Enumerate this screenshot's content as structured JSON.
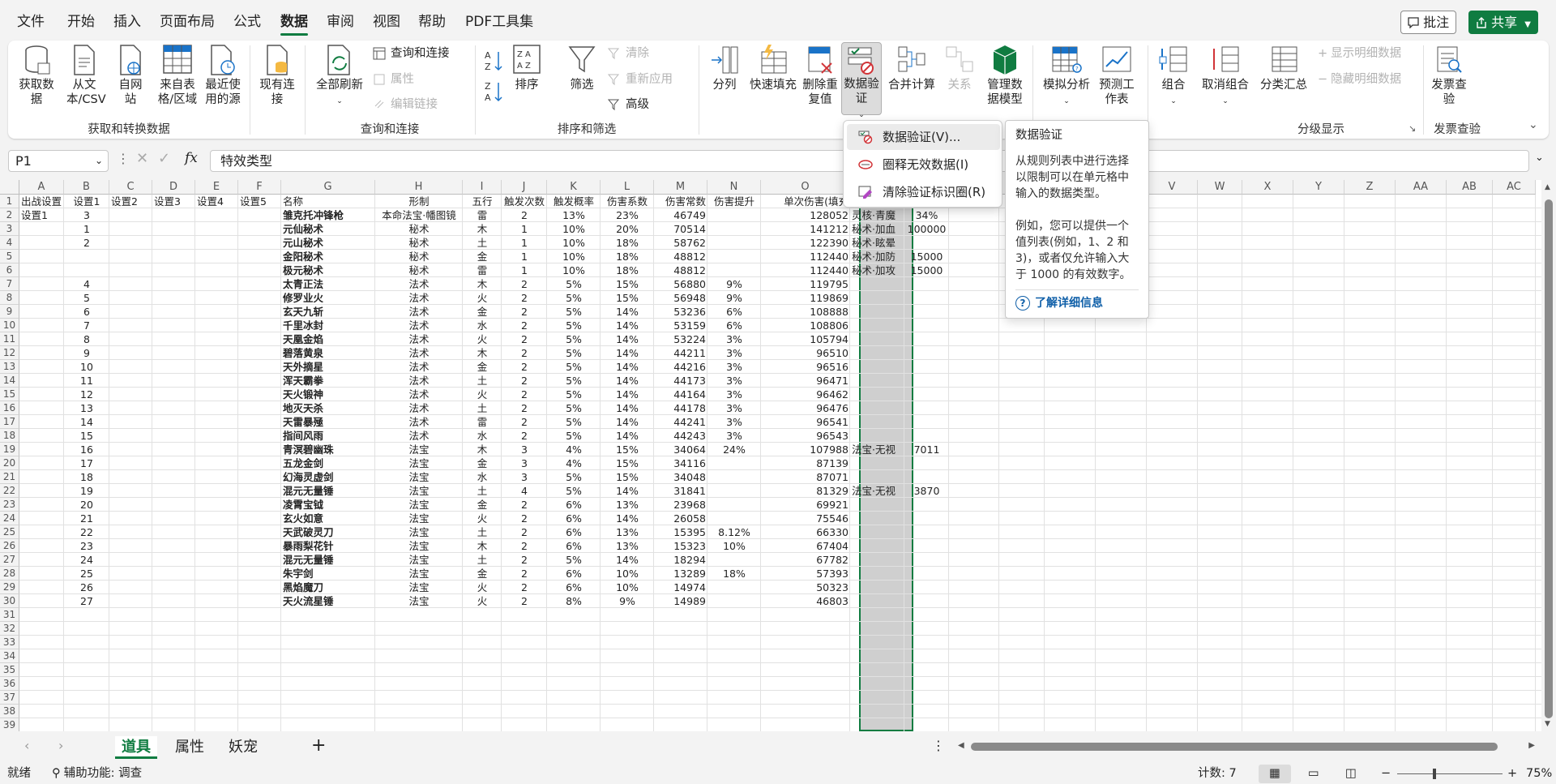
{
  "menu": {
    "file": "文件",
    "home": "开始",
    "insert": "插入",
    "page_layout": "页面布局",
    "formulas": "公式",
    "data": "数据",
    "review": "审阅",
    "view": "视图",
    "help": "帮助",
    "pdf": "PDF工具集",
    "comments": "批注",
    "share": "共享"
  },
  "ribbon": {
    "get_data": "获取数据",
    "from_text": "从文本/CSV",
    "from_web": "自网站",
    "from_table": "来自表格/区域",
    "recent_sources": "最近使用的源",
    "existing_connections": "现有连接",
    "group_get": "获取和转换数据",
    "refresh_all": "全部刷新",
    "queries_connections": "查询和连接",
    "properties": "属性",
    "edit_links": "编辑链接",
    "group_queries": "查询和连接",
    "sort_az": "A→Z",
    "sort_za": "Z→A",
    "sort": "排序",
    "filter": "筛选",
    "clear": "清除",
    "reapply": "重新应用",
    "advanced": "高级",
    "group_sort": "排序和筛选",
    "text_to_columns": "分列",
    "flash_fill": "快速填充",
    "remove_duplicates": "删除重复值",
    "data_validation": "数据验证",
    "consolidate": "合并计算",
    "relationships": "关系",
    "manage_model": "管理数据模型",
    "what_if": "模拟分析",
    "forecast": "预测工作表",
    "group_btn": "组合",
    "ungroup": "取消组合",
    "subtotal": "分类汇总",
    "show_detail": "显示明细数据",
    "hide_detail": "隐藏明细数据",
    "group_outline": "分级显示",
    "invoice_check": "发票查验",
    "group_invoice": "发票查验"
  },
  "formula_bar": {
    "name_box": "P1",
    "content": "特效类型"
  },
  "columns": [
    {
      "name": "A",
      "label": "出战设置"
    },
    {
      "name": "B",
      "label": "设置1"
    },
    {
      "name": "C",
      "label": "设置2"
    },
    {
      "name": "D",
      "label": "设置3"
    },
    {
      "name": "E",
      "label": "设置4"
    },
    {
      "name": "F",
      "label": "设置5"
    },
    {
      "name": "G",
      "label": "名称"
    },
    {
      "name": "H",
      "label": "形制"
    },
    {
      "name": "I",
      "label": "五行"
    },
    {
      "name": "J",
      "label": "触发次数"
    },
    {
      "name": "K",
      "label": "触发概率"
    },
    {
      "name": "L",
      "label": "伤害系数"
    },
    {
      "name": "M",
      "label": "伤害常数"
    },
    {
      "name": "N",
      "label": "伤害提升"
    },
    {
      "name": "O",
      "label": "单次伤害(填充"
    },
    {
      "name": "P",
      "label": ""
    },
    {
      "name": "Q",
      "label": ""
    },
    {
      "name": "R",
      "label": ""
    },
    {
      "name": "S",
      "label": ""
    },
    {
      "name": "T",
      "label": ""
    },
    {
      "name": "U",
      "label": ""
    },
    {
      "name": "V",
      "label": ""
    },
    {
      "name": "W",
      "label": ""
    },
    {
      "name": "X",
      "label": ""
    },
    {
      "name": "Y",
      "label": ""
    },
    {
      "name": "Z",
      "label": ""
    },
    {
      "name": "AA",
      "label": ""
    },
    {
      "name": "AB",
      "label": ""
    },
    {
      "name": "AC",
      "label": ""
    }
  ],
  "rows": [
    [
      "设置1",
      "3",
      "",
      "",
      "",
      "",
      "雏克托冲锋枪",
      "本命法宝·幡图镜",
      "雷",
      "2",
      "13%",
      "23%",
      "46749",
      "",
      "128052",
      "灵核·青魔",
      "34%"
    ],
    [
      "",
      "1",
      "",
      "",
      "",
      "",
      "元仙秘术",
      "秘术",
      "木",
      "1",
      "10%",
      "20%",
      "70514",
      "",
      "141212",
      "秘术·加血",
      "100000"
    ],
    [
      "",
      "2",
      "",
      "",
      "",
      "",
      "元山秘术",
      "秘术",
      "土",
      "1",
      "10%",
      "18%",
      "58762",
      "",
      "122390",
      "秘术·眩晕",
      ""
    ],
    [
      "",
      "",
      "",
      "",
      "",
      "",
      "金阳秘术",
      "秘术",
      "金",
      "1",
      "10%",
      "18%",
      "48812",
      "",
      "112440",
      "秘术·加防",
      "15000"
    ],
    [
      "",
      "",
      "",
      "",
      "",
      "",
      "极元秘术",
      "秘术",
      "雷",
      "1",
      "10%",
      "18%",
      "48812",
      "",
      "112440",
      "秘术·加攻",
      "15000"
    ],
    [
      "",
      "4",
      "",
      "",
      "",
      "",
      "太青正法",
      "法术",
      "木",
      "2",
      "5%",
      "15%",
      "56880",
      "9%",
      "119795",
      "",
      ""
    ],
    [
      "",
      "5",
      "",
      "",
      "",
      "",
      "修罗业火",
      "法术",
      "火",
      "2",
      "5%",
      "15%",
      "56948",
      "9%",
      "119869",
      "",
      ""
    ],
    [
      "",
      "6",
      "",
      "",
      "",
      "",
      "玄天九斩",
      "法术",
      "金",
      "2",
      "5%",
      "14%",
      "53236",
      "6%",
      "108888",
      "",
      ""
    ],
    [
      "",
      "7",
      "",
      "",
      "",
      "",
      "千里冰封",
      "法术",
      "水",
      "2",
      "5%",
      "14%",
      "53159",
      "6%",
      "108806",
      "",
      ""
    ],
    [
      "",
      "8",
      "",
      "",
      "",
      "",
      "天凰金焰",
      "法术",
      "火",
      "2",
      "5%",
      "14%",
      "53224",
      "3%",
      "105794",
      "",
      ""
    ],
    [
      "",
      "9",
      "",
      "",
      "",
      "",
      "碧落黄泉",
      "法术",
      "木",
      "2",
      "5%",
      "14%",
      "44211",
      "3%",
      "96510",
      "",
      ""
    ],
    [
      "",
      "10",
      "",
      "",
      "",
      "",
      "天外摘星",
      "法术",
      "金",
      "2",
      "5%",
      "14%",
      "44216",
      "3%",
      "96516",
      "",
      ""
    ],
    [
      "",
      "11",
      "",
      "",
      "",
      "",
      "浑天霸拳",
      "法术",
      "土",
      "2",
      "5%",
      "14%",
      "44173",
      "3%",
      "96471",
      "",
      ""
    ],
    [
      "",
      "12",
      "",
      "",
      "",
      "",
      "天火锻神",
      "法术",
      "火",
      "2",
      "5%",
      "14%",
      "44164",
      "3%",
      "96462",
      "",
      ""
    ],
    [
      "",
      "13",
      "",
      "",
      "",
      "",
      "地灭天杀",
      "法术",
      "土",
      "2",
      "5%",
      "14%",
      "44178",
      "3%",
      "96476",
      "",
      ""
    ],
    [
      "",
      "14",
      "",
      "",
      "",
      "",
      "天雷暴殛",
      "法术",
      "雷",
      "2",
      "5%",
      "14%",
      "44241",
      "3%",
      "96541",
      "",
      ""
    ],
    [
      "",
      "15",
      "",
      "",
      "",
      "",
      "指间风雨",
      "法术",
      "水",
      "2",
      "5%",
      "14%",
      "44243",
      "3%",
      "96543",
      "",
      ""
    ],
    [
      "",
      "16",
      "",
      "",
      "",
      "",
      "青溟碧幽珠",
      "法宝",
      "木",
      "3",
      "4%",
      "15%",
      "34064",
      "24%",
      "107988",
      "法宝·无视",
      "7011"
    ],
    [
      "",
      "17",
      "",
      "",
      "",
      "",
      "五龙金剑",
      "法宝",
      "金",
      "3",
      "4%",
      "15%",
      "34116",
      "",
      "87139",
      "",
      ""
    ],
    [
      "",
      "18",
      "",
      "",
      "",
      "",
      "幻海灵虚剑",
      "法宝",
      "水",
      "3",
      "5%",
      "15%",
      "34048",
      "",
      "87071",
      "",
      ""
    ],
    [
      "",
      "19",
      "",
      "",
      "",
      "",
      "混元无量锤",
      "法宝",
      "土",
      "4",
      "5%",
      "14%",
      "31841",
      "",
      "81329",
      "法宝·无视",
      "3870"
    ],
    [
      "",
      "20",
      "",
      "",
      "",
      "",
      "凌霄宝钺",
      "法宝",
      "金",
      "2",
      "6%",
      "13%",
      "23968",
      "",
      "69921",
      "",
      ""
    ],
    [
      "",
      "21",
      "",
      "",
      "",
      "",
      "玄火如意",
      "法宝",
      "火",
      "2",
      "6%",
      "14%",
      "26058",
      "",
      "75546",
      "",
      ""
    ],
    [
      "",
      "22",
      "",
      "",
      "",
      "",
      "天武破灵刀",
      "法宝",
      "土",
      "2",
      "6%",
      "13%",
      "15395",
      "8.12%",
      "66330",
      "",
      ""
    ],
    [
      "",
      "23",
      "",
      "",
      "",
      "",
      "暴雨梨花针",
      "法宝",
      "木",
      "2",
      "6%",
      "13%",
      "15323",
      "10%",
      "67404",
      "",
      ""
    ],
    [
      "",
      "24",
      "",
      "",
      "",
      "",
      "混元无量锤",
      "法宝",
      "土",
      "2",
      "5%",
      "14%",
      "18294",
      "",
      "67782",
      "",
      ""
    ],
    [
      "",
      "25",
      "",
      "",
      "",
      "",
      "朱宇剑",
      "法宝",
      "金",
      "2",
      "6%",
      "10%",
      "13289",
      "18%",
      "57393",
      "",
      ""
    ],
    [
      "",
      "26",
      "",
      "",
      "",
      "",
      "黑焰魔刀",
      "法宝",
      "火",
      "2",
      "6%",
      "10%",
      "14974",
      "",
      "50323",
      "",
      ""
    ],
    [
      "",
      "27",
      "",
      "",
      "",
      "",
      "天火流星锤",
      "法宝",
      "火",
      "2",
      "8%",
      "9%",
      "14989",
      "",
      "46803",
      "",
      ""
    ]
  ],
  "dropdown": {
    "item1": "数据验证(V)...",
    "item2": "圈释无效数据(I)",
    "item3": "清除验证标识圈(R)"
  },
  "tooltip": {
    "title": "数据验证",
    "desc": "从规则列表中进行选择以限制可以在单元格中输入的数据类型。",
    "example": "例如，您可以提供一个值列表(例如，1、2 和 3)，或者仅允许输入大于 1000 的有效数字。",
    "link": "了解详细信息"
  },
  "sheets": {
    "tab1": "道具",
    "tab2": "属性",
    "tab3": "妖宠"
  },
  "status": {
    "ready": "就绪",
    "accessibility": "辅助功能: 调查",
    "count": "计数: 7",
    "zoom": "75%"
  }
}
